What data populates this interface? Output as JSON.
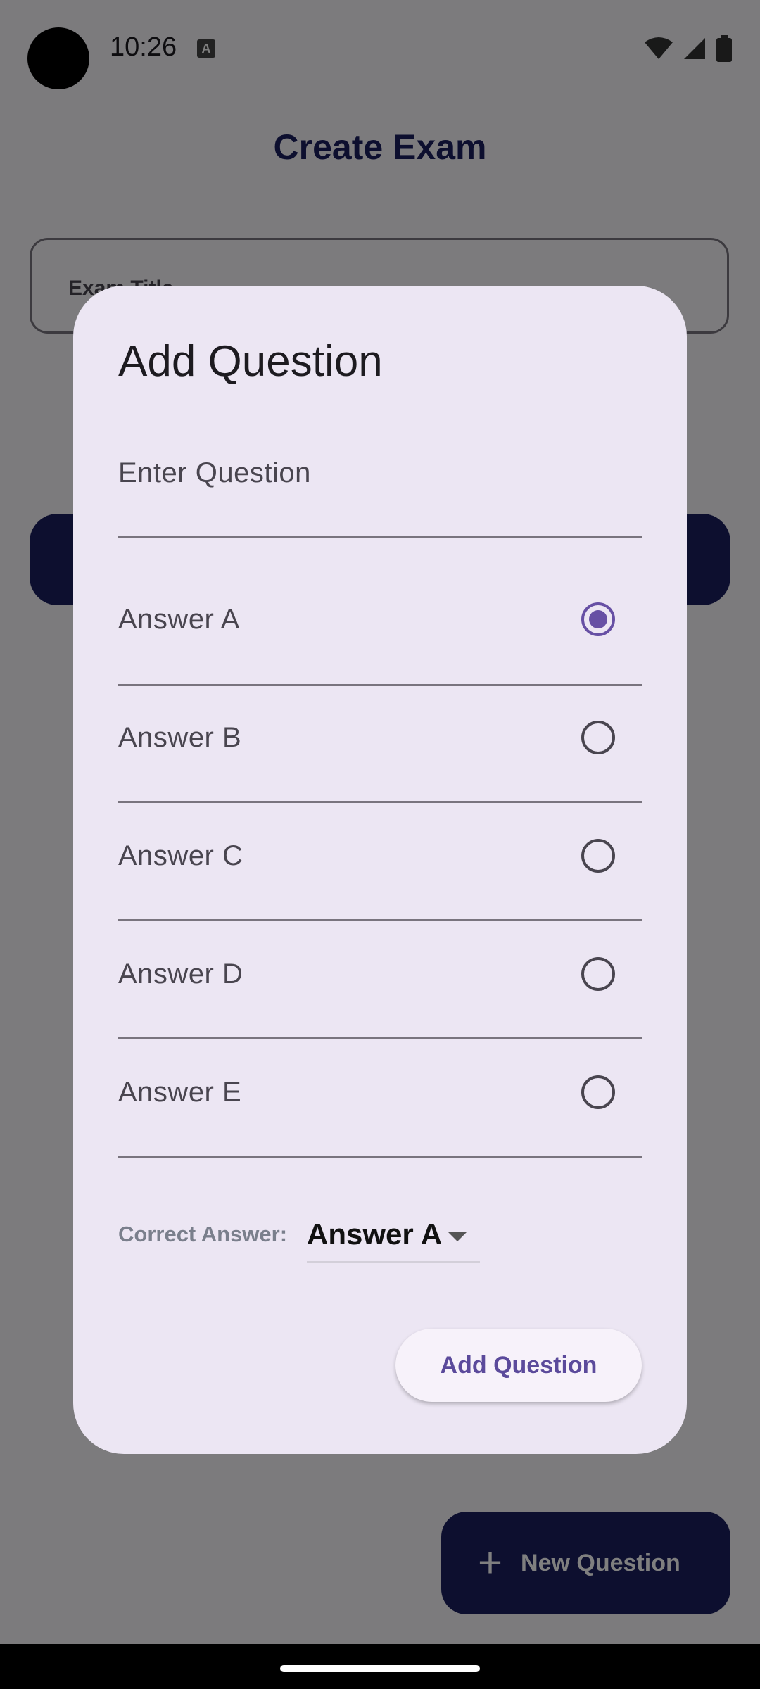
{
  "status_bar": {
    "time": "10:26",
    "notification_icon": "A"
  },
  "page": {
    "title": "Create Exam",
    "exam_title_label": "Exam Title",
    "fab_label": "New Question"
  },
  "dialog": {
    "title": "Add Question",
    "question_placeholder": "Enter Question",
    "answers": [
      {
        "label": "Answer A",
        "selected": true
      },
      {
        "label": "Answer B",
        "selected": false
      },
      {
        "label": "Answer C",
        "selected": false
      },
      {
        "label": "Answer D",
        "selected": false
      },
      {
        "label": "Answer E",
        "selected": false
      }
    ],
    "correct_answer_label": "Correct Answer:",
    "correct_answer_value": "Answer A",
    "submit_label": "Add Question"
  },
  "colors": {
    "primary": "#1a1f5e",
    "accent": "#6750a4",
    "dialog_bg": "#ece6f3"
  }
}
